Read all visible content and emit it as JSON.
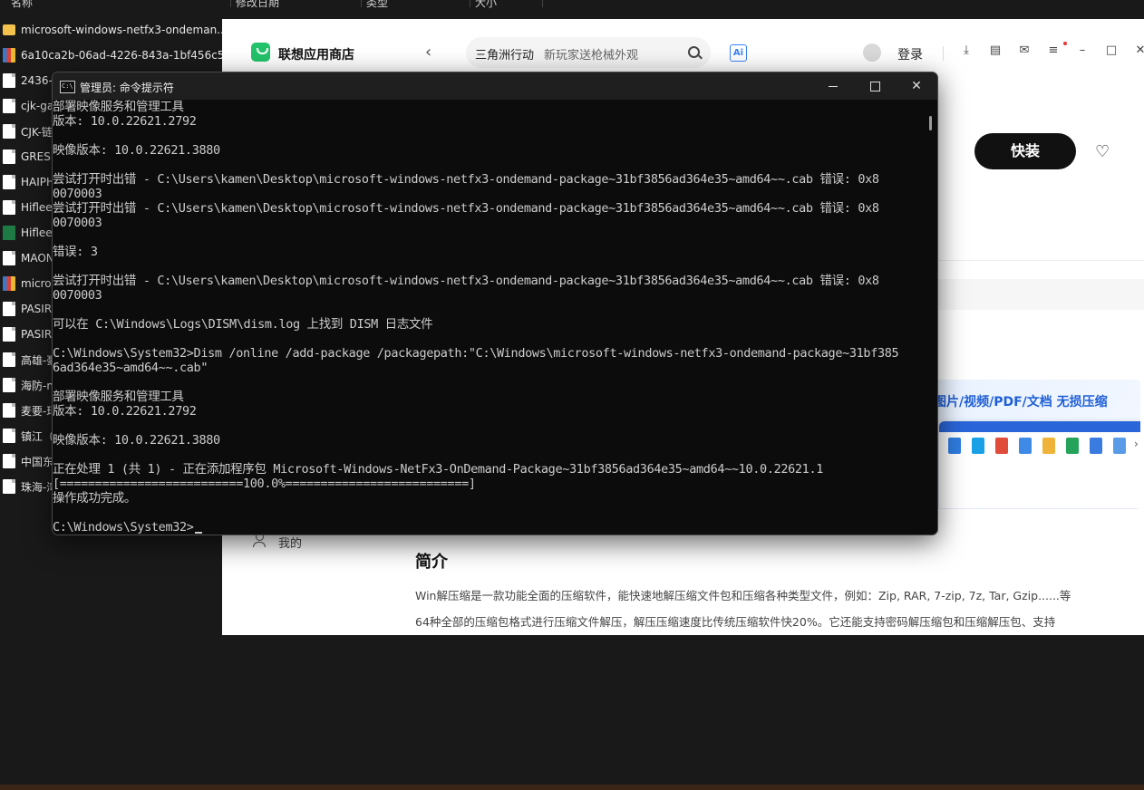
{
  "explorer": {
    "headers": [
      "名称",
      "修改日期",
      "类型",
      "大小"
    ],
    "files": [
      {
        "name": "microsoft-windows-netfx3-ondeman...",
        "icon": "folder-icon"
      },
      {
        "name": "6a10ca2b-06ad-4226-843a-1bf456c5...",
        "icon": "archive-icon"
      },
      {
        "name": "2436-7",
        "icon": "document-icon"
      },
      {
        "name": "cjk-ga",
        "icon": "document-icon"
      },
      {
        "name": "CJK-链",
        "icon": "document-icon"
      },
      {
        "name": "GRESI",
        "icon": "document-icon"
      },
      {
        "name": "HAIPH",
        "icon": "document-icon"
      },
      {
        "name": "Hifleet",
        "icon": "document-icon"
      },
      {
        "name": "Hifleet",
        "icon": "spreadsheet-icon"
      },
      {
        "name": "MAON",
        "icon": "document-icon"
      },
      {
        "name": "micros",
        "icon": "archive-icon"
      },
      {
        "name": "PASIR",
        "icon": "document-icon"
      },
      {
        "name": "PASIR",
        "icon": "document-icon"
      },
      {
        "name": "高雄-豪",
        "icon": "document-icon"
      },
      {
        "name": "海防-n",
        "icon": "document-icon"
      },
      {
        "name": "麦要-玛",
        "icon": "document-icon"
      },
      {
        "name": "镇江（",
        "icon": "document-icon"
      },
      {
        "name": "中国东",
        "icon": "document-icon"
      },
      {
        "name": "珠海-湾",
        "icon": "document-icon"
      }
    ]
  },
  "store": {
    "brand": "联想应用商店",
    "search_hot": "三角洲行动",
    "search_placeholder": "新玩家送枪械外观",
    "ai_label": "Ai",
    "login": "登录",
    "install_button": "快装",
    "sidebar_me": "我的",
    "banner_title": "图片/视频/PDF/文档 无损压缩",
    "intro_title": "简介",
    "intro_line1": "Win解压缩是一款功能全面的压缩软件，能快速地解压缩文件包和压缩各种类型文件，例如：Zip, RAR, 7-zip, 7z, Tar, Gzip......等",
    "intro_line2": "64种全部的压缩包格式进行压缩文件解压，解压压缩速度比传统压缩软件快20%。它还能支持密码解压缩包和压缩解压包、支持"
  },
  "cmd": {
    "title": "管理员: 命令提示符",
    "icon_text": "C:\\",
    "lines": [
      "部署映像服务和管理工具",
      "版本: 10.0.22621.2792",
      "",
      "映像版本: 10.0.22621.3880",
      "",
      "尝试打开时出错 - C:\\Users\\kamen\\Desktop\\microsoft-windows-netfx3-ondemand-package~31bf3856ad364e35~amd64~~.cab 错误: 0x8",
      "0070003",
      "尝试打开时出错 - C:\\Users\\kamen\\Desktop\\microsoft-windows-netfx3-ondemand-package~31bf3856ad364e35~amd64~~.cab 错误: 0x8",
      "0070003",
      "",
      "错误: 3",
      "",
      "尝试打开时出错 - C:\\Users\\kamen\\Desktop\\microsoft-windows-netfx3-ondemand-package~31bf3856ad364e35~amd64~~.cab 错误: 0x8",
      "0070003",
      "",
      "可以在 C:\\Windows\\Logs\\DISM\\dism.log 上找到 DISM 日志文件",
      "",
      "C:\\Windows\\System32>Dism /online /add-package /packagepath:\"C:\\Windows\\microsoft-windows-netfx3-ondemand-package~31bf385",
      "6ad364e35~amd64~~.cab\"",
      "",
      "部署映像服务和管理工具",
      "版本: 10.0.22621.2792",
      "",
      "映像版本: 10.0.22621.3880",
      "",
      "正在处理 1 (共 1) - 正在添加程序包 Microsoft-Windows-NetFx3-OnDemand-Package~31bf3856ad364e35~amd64~~10.0.22621.1",
      "[==========================100.0%==========================]",
      "操作成功完成。",
      "",
      "C:\\Windows\\System32>"
    ]
  }
}
